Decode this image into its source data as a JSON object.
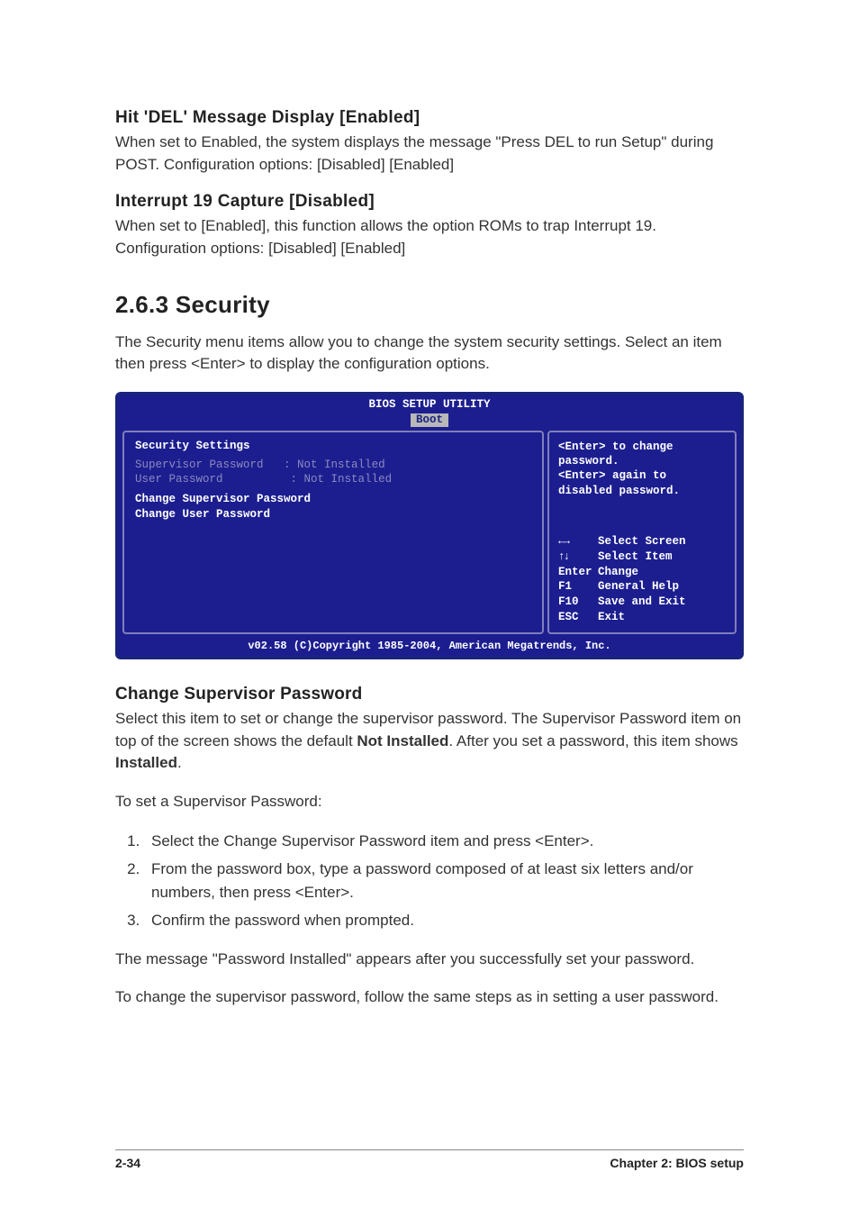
{
  "section1": {
    "heading": "Hit 'DEL' Message Display [Enabled]",
    "body": "When set to Enabled, the system displays the message \"Press DEL to run Setup\" during POST. Configuration options: [Disabled] [Enabled]"
  },
  "section2": {
    "heading": "Interrupt 19 Capture [Disabled]",
    "body": "When set to [Enabled], this function allows the option ROMs to trap Interrupt 19. Configuration options: [Disabled] [Enabled]"
  },
  "security": {
    "title": "2.6.3   Security",
    "intro": "The Security menu items allow you to change the system security settings. Select an item then press <Enter> to display the configuration options."
  },
  "bios": {
    "header_line1": "BIOS SETUP UTILITY",
    "header_tab": "Boot",
    "left": {
      "title": "Security Settings",
      "rows": [
        {
          "label": "Supervisor Password",
          "value": ": Not Installed"
        },
        {
          "label": "User Password",
          "value": ": Not Installed"
        }
      ],
      "items": [
        "Change Supervisor Password",
        "Change User Password"
      ]
    },
    "right": {
      "help": "<Enter> to change password.\n<Enter> again to disabled password.",
      "nav": [
        {
          "key": "lr",
          "label": "Select Screen"
        },
        {
          "key": "ud",
          "label": "Select Item"
        },
        {
          "key": "Enter",
          "label": "Change"
        },
        {
          "key": "F1",
          "label": "General Help"
        },
        {
          "key": "F10",
          "label": "Save and Exit"
        },
        {
          "key": "ESC",
          "label": "Exit"
        }
      ]
    },
    "footer": "v02.58 (C)Copyright 1985-2004, American Megatrends, Inc."
  },
  "change_pw": {
    "heading": "Change Supervisor Password",
    "body_pre": "Select this item to set or change the supervisor password. The Supervisor Password item on top of the screen shows the default ",
    "bold1": "Not Installed",
    "body_mid": ". After you set a password, this item shows ",
    "bold2": "Installed",
    "body_post": ".",
    "to_set": "To set a Supervisor Password:",
    "steps": [
      "Select the Change Supervisor Password item and press <Enter>.",
      "From the password box, type a password composed of at least six letters and/or numbers, then press <Enter>.",
      "Confirm the password when prompted."
    ],
    "msg_after": "The message \"Password Installed\" appears after you successfully set your password.",
    "to_change": "To change the supervisor password, follow the same steps as in setting a user password."
  },
  "footer": {
    "left": "2-34",
    "right": "Chapter 2: BIOS setup"
  }
}
